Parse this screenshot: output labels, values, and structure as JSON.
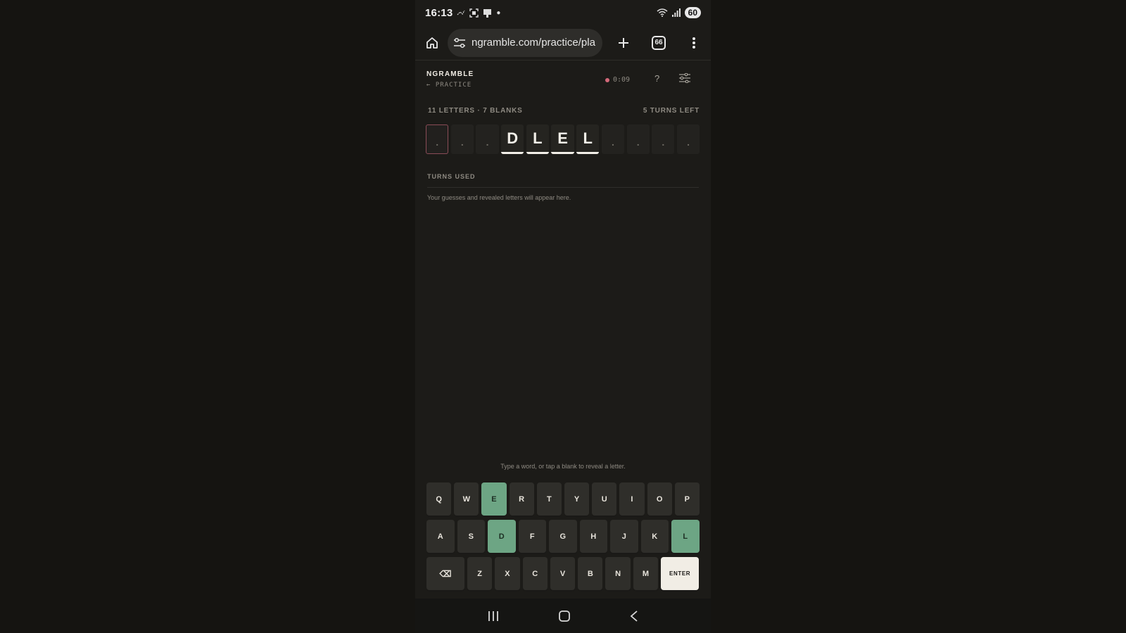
{
  "status": {
    "time": "16:13",
    "battery": "60",
    "notification_icons": [
      "missed-call-icon",
      "screenshot-icon",
      "cast-icon",
      "dot-icon"
    ],
    "right_icons": [
      "wifi-icon",
      "signal-icon"
    ]
  },
  "browser": {
    "url": "ngramble.com/practice/pla",
    "tab_count": "66",
    "icons": [
      "home-icon",
      "site-settings-icon",
      "plus-icon",
      "tabs-icon",
      "more-vertical-icon"
    ]
  },
  "app": {
    "title": "NGRAMBLE",
    "back_label": "←  PRACTICE",
    "timer": "0:09",
    "help": "?"
  },
  "puzzle": {
    "letters_info": "11 LETTERS · 7 BLANKS",
    "turns_left": "5 TURNS LEFT",
    "tiles": [
      {
        "char": ".",
        "state": "blank-selected"
      },
      {
        "char": ".",
        "state": "blank"
      },
      {
        "char": ".",
        "state": "blank"
      },
      {
        "char": "D",
        "state": "revealed"
      },
      {
        "char": "L",
        "state": "revealed"
      },
      {
        "char": "E",
        "state": "revealed"
      },
      {
        "char": "L",
        "state": "revealed"
      },
      {
        "char": ".",
        "state": "blank"
      },
      {
        "char": ".",
        "state": "blank"
      },
      {
        "char": ".",
        "state": "blank"
      },
      {
        "char": ".",
        "state": "blank"
      }
    ]
  },
  "turns": {
    "heading": "TURNS USED",
    "empty_message": "Your guesses and revealed letters will appear here."
  },
  "hint": "Type a word, or tap a blank to reveal a letter.",
  "keyboard": {
    "rows": [
      [
        "Q",
        "W",
        "E",
        "R",
        "T",
        "Y",
        "U",
        "I",
        "O",
        "P"
      ],
      [
        "A",
        "S",
        "D",
        "F",
        "G",
        "H",
        "J",
        "K",
        "L"
      ],
      [
        "⌫",
        "Z",
        "X",
        "C",
        "V",
        "B",
        "N",
        "M",
        "ENTER"
      ]
    ],
    "used": [
      "E",
      "D",
      "L"
    ]
  },
  "colors": {
    "used_key": "#6da584",
    "timer_dot": "#d4697a",
    "selected_tile_border": "#8a4c57"
  },
  "nav_icons": [
    "recent-apps-icon",
    "home-nav-icon",
    "back-nav-icon"
  ]
}
